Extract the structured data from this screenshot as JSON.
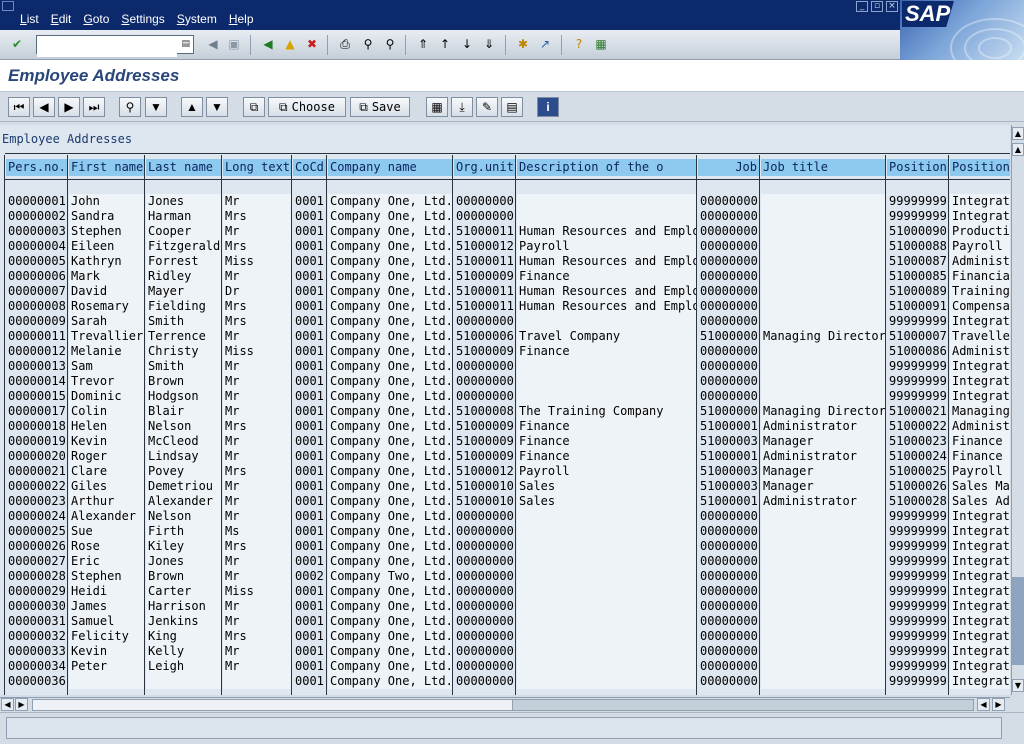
{
  "menu": [
    "List",
    "Edit",
    "Goto",
    "Settings",
    "System",
    "Help"
  ],
  "sap_logo_text": "SAP",
  "command_field": {
    "value": "",
    "placeholder": ""
  },
  "title": "Employee Addresses",
  "app_toolbar": {
    "choose_label": "Choose",
    "save_label": "Save"
  },
  "list": {
    "heading": "Employee Addresses",
    "columns": [
      "Pers.no.",
      "First name",
      "Last name",
      "Long text",
      "CoCd",
      "Company name",
      "Org.unit",
      "Description of the o",
      "Job",
      "Job title",
      "Position",
      "Position"
    ],
    "rows": [
      [
        "00000001",
        "John",
        "Jones",
        "Mr",
        "0001",
        "Company One, Ltd.",
        "00000000",
        "",
        "00000000",
        "",
        "99999999",
        "Integrat"
      ],
      [
        "00000002",
        "Sandra",
        "Harman",
        "Mrs",
        "0001",
        "Company One, Ltd.",
        "00000000",
        "",
        "00000000",
        "",
        "99999999",
        "Integrat"
      ],
      [
        "00000003",
        "Stephen",
        "Cooper",
        "Mr",
        "0001",
        "Company One, Ltd.",
        "51000011",
        "Human Resources and Emplo",
        "00000000",
        "",
        "51000090",
        "Producti"
      ],
      [
        "00000004",
        "Eileen",
        "Fitzgerald",
        "Mrs",
        "0001",
        "Company One, Ltd.",
        "51000012",
        "Payroll",
        "00000000",
        "",
        "51000088",
        "Payroll"
      ],
      [
        "00000005",
        "Kathryn",
        "Forrest",
        "Miss",
        "0001",
        "Company One, Ltd.",
        "51000011",
        "Human Resources and Emplo",
        "00000000",
        "",
        "51000087",
        "Administ"
      ],
      [
        "00000006",
        "Mark",
        "Ridley",
        "Mr",
        "0001",
        "Company One, Ltd.",
        "51000009",
        "Finance",
        "00000000",
        "",
        "51000085",
        "Financia"
      ],
      [
        "00000007",
        "David",
        "Mayer",
        "Dr",
        "0001",
        "Company One, Ltd.",
        "51000011",
        "Human Resources and Emplo",
        "00000000",
        "",
        "51000089",
        "Training"
      ],
      [
        "00000008",
        "Rosemary",
        "Fielding",
        "Mrs",
        "0001",
        "Company One, Ltd.",
        "51000011",
        "Human Resources and Emplo",
        "00000000",
        "",
        "51000091",
        "Compensa"
      ],
      [
        "00000009",
        "Sarah",
        "Smith",
        "Mrs",
        "0001",
        "Company One, Ltd.",
        "00000000",
        "",
        "00000000",
        "",
        "99999999",
        "Integrat"
      ],
      [
        "00000011",
        "Trevallier",
        "Terrence",
        "Mr",
        "0001",
        "Company One, Ltd.",
        "51000006",
        "Travel Company",
        "51000000",
        "Managing Director",
        "51000007",
        "Travelle"
      ],
      [
        "00000012",
        "Melanie",
        "Christy",
        "Miss",
        "0001",
        "Company One, Ltd.",
        "51000009",
        "Finance",
        "00000000",
        "",
        "51000086",
        "Administ"
      ],
      [
        "00000013",
        "Sam",
        "Smith",
        "Mr",
        "0001",
        "Company One, Ltd.",
        "00000000",
        "",
        "00000000",
        "",
        "99999999",
        "Integrat"
      ],
      [
        "00000014",
        "Trevor",
        "Brown",
        "Mr",
        "0001",
        "Company One, Ltd.",
        "00000000",
        "",
        "00000000",
        "",
        "99999999",
        "Integrat"
      ],
      [
        "00000015",
        "Dominic",
        "Hodgson",
        "Mr",
        "0001",
        "Company One, Ltd.",
        "00000000",
        "",
        "00000000",
        "",
        "99999999",
        "Integrat"
      ],
      [
        "00000017",
        "Colin",
        "Blair",
        "Mr",
        "0001",
        "Company One, Ltd.",
        "51000008",
        "The Training Company",
        "51000000",
        "Managing Director",
        "51000021",
        "Managing"
      ],
      [
        "00000018",
        "Helen",
        "Nelson",
        "Mrs",
        "0001",
        "Company One, Ltd.",
        "51000009",
        "Finance",
        "51000001",
        "Administrator",
        "51000022",
        "Administ"
      ],
      [
        "00000019",
        "Kevin",
        "McCleod",
        "Mr",
        "0001",
        "Company One, Ltd.",
        "51000009",
        "Finance",
        "51000003",
        "Manager",
        "51000023",
        "Finance"
      ],
      [
        "00000020",
        "Roger",
        "Lindsay",
        "Mr",
        "0001",
        "Company One, Ltd.",
        "51000009",
        "Finance",
        "51000001",
        "Administrator",
        "51000024",
        "Finance"
      ],
      [
        "00000021",
        "Clare",
        "Povey",
        "Mrs",
        "0001",
        "Company One, Ltd.",
        "51000012",
        "Payroll",
        "51000003",
        "Manager",
        "51000025",
        "Payroll"
      ],
      [
        "00000022",
        "Giles",
        "Demetriou",
        "Mr",
        "0001",
        "Company One, Ltd.",
        "51000010",
        "Sales",
        "51000003",
        "Manager",
        "51000026",
        "Sales Ma"
      ],
      [
        "00000023",
        "Arthur",
        "Alexander",
        "Mr",
        "0001",
        "Company One, Ltd.",
        "51000010",
        "Sales",
        "51000001",
        "Administrator",
        "51000028",
        "Sales Ad"
      ],
      [
        "00000024",
        "Alexander",
        "Nelson",
        "Mr",
        "0001",
        "Company One, Ltd.",
        "00000000",
        "",
        "00000000",
        "",
        "99999999",
        "Integrat"
      ],
      [
        "00000025",
        "Sue",
        "Firth",
        "Ms",
        "0001",
        "Company One, Ltd.",
        "00000000",
        "",
        "00000000",
        "",
        "99999999",
        "Integrat"
      ],
      [
        "00000026",
        "Rose",
        "Kiley",
        "Mrs",
        "0001",
        "Company One, Ltd.",
        "00000000",
        "",
        "00000000",
        "",
        "99999999",
        "Integrat"
      ],
      [
        "00000027",
        "Eric",
        "Jones",
        "Mr",
        "0001",
        "Company One, Ltd.",
        "00000000",
        "",
        "00000000",
        "",
        "99999999",
        "Integrat"
      ],
      [
        "00000028",
        "Stephen",
        "Brown",
        "Mr",
        "0002",
        "Company Two, Ltd.",
        "00000000",
        "",
        "00000000",
        "",
        "99999999",
        "Integrat"
      ],
      [
        "00000029",
        "Heidi",
        "Carter",
        "Miss",
        "0001",
        "Company One, Ltd.",
        "00000000",
        "",
        "00000000",
        "",
        "99999999",
        "Integrat"
      ],
      [
        "00000030",
        "James",
        "Harrison",
        "Mr",
        "0001",
        "Company One, Ltd.",
        "00000000",
        "",
        "00000000",
        "",
        "99999999",
        "Integrat"
      ],
      [
        "00000031",
        "Samuel",
        "Jenkins",
        "Mr",
        "0001",
        "Company One, Ltd.",
        "00000000",
        "",
        "00000000",
        "",
        "99999999",
        "Integrat"
      ],
      [
        "00000032",
        "Felicity",
        "King",
        "Mrs",
        "0001",
        "Company One, Ltd.",
        "00000000",
        "",
        "00000000",
        "",
        "99999999",
        "Integrat"
      ],
      [
        "00000033",
        "Kevin",
        "Kelly",
        "Mr",
        "0001",
        "Company One, Ltd.",
        "00000000",
        "",
        "00000000",
        "",
        "99999999",
        "Integrat"
      ],
      [
        "00000034",
        "Peter",
        "Leigh",
        "Mr",
        "0001",
        "Company One, Ltd.",
        "00000000",
        "",
        "00000000",
        "",
        "99999999",
        "Integrat"
      ],
      [
        "00000036",
        "",
        "",
        "",
        "0001",
        "Company One, Ltd.",
        "00000000",
        "",
        "00000000",
        "",
        "99999999",
        "Integrat"
      ]
    ]
  },
  "colors": {
    "header_bg": "#8ec9ef",
    "title": "#29467b",
    "menubar": "#0c2a6b"
  }
}
